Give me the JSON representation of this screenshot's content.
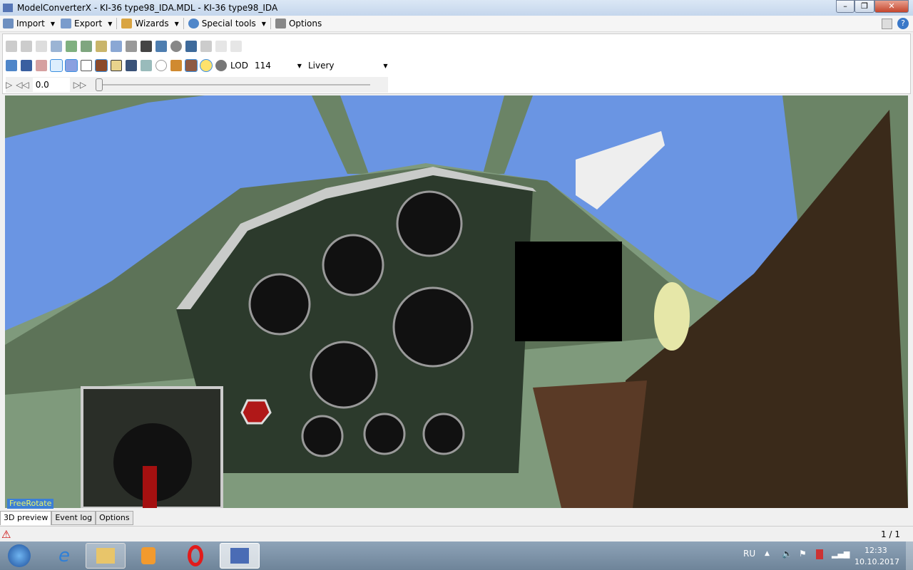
{
  "window": {
    "title": "ModelConverterX - KI-36 type98_IDA.MDL - KI-36 type98_IDA",
    "min": "–",
    "max": "❐",
    "close": "✕"
  },
  "menu": [
    {
      "label": "Import",
      "icon": "import-icon"
    },
    {
      "label": "Export",
      "icon": "export-icon"
    },
    {
      "label": "Wizards",
      "icon": "wand-icon"
    },
    {
      "label": "Special tools",
      "icon": "gear-icon"
    },
    {
      "label": "Options",
      "icon": "tools-icon"
    }
  ],
  "toolbar": {
    "lod_label": "LOD",
    "lod_value": "114",
    "livery_label": "Livery",
    "livery_value": "",
    "time_value": "0.0",
    "timeline_position": 0
  },
  "viewport": {
    "mode": "FreeRotate"
  },
  "tabs": [
    {
      "label": "3D preview",
      "active": true
    },
    {
      "label": "Event log"
    },
    {
      "label": "Options"
    }
  ],
  "status": {
    "page": "1 / 1"
  },
  "taskbar": {
    "lang": "RU",
    "time": "12:33",
    "date": "10.10.2017"
  },
  "colors": {
    "sky": "#6a95e3",
    "frame": "#6b8466",
    "panel": "#2c3a2c"
  }
}
